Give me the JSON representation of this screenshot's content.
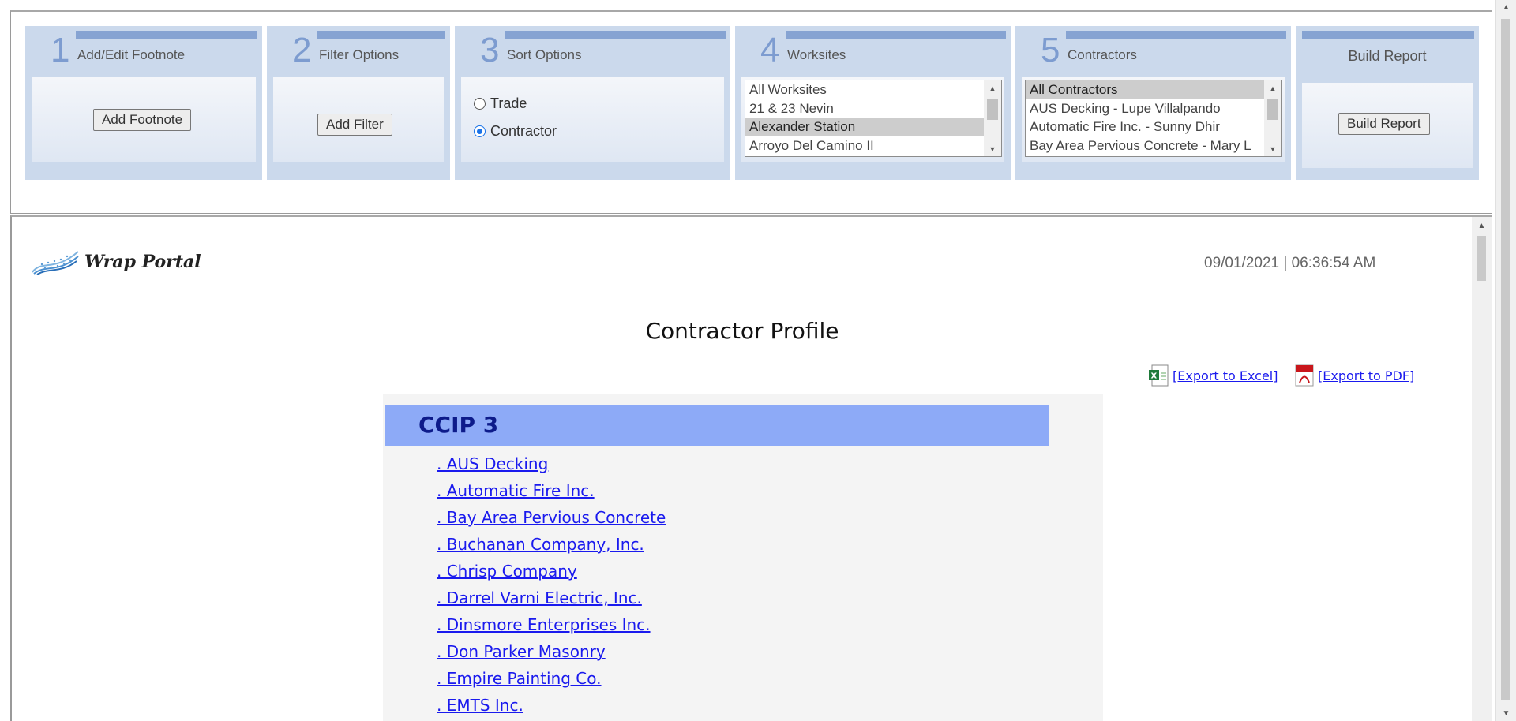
{
  "steps": [
    {
      "num": "1",
      "title": "Add/Edit Footnote",
      "button": "Add Footnote"
    },
    {
      "num": "2",
      "title": "Filter Options",
      "button": "Add Filter"
    },
    {
      "num": "3",
      "title": "Sort Options",
      "radios": [
        {
          "label": "Trade",
          "checked": false
        },
        {
          "label": "Contractor",
          "checked": true
        }
      ]
    },
    {
      "num": "4",
      "title": "Worksites",
      "options": [
        "All Worksites",
        "21 & 23 Nevin",
        "Alexander Station",
        "Arroyo Del Camino II"
      ],
      "selected": "Alexander Station"
    },
    {
      "num": "5",
      "title": "Contractors",
      "options": [
        "All Contractors",
        "AUS Decking - Lupe Villalpando",
        "Automatic Fire Inc. - Sunny Dhir",
        "Bay Area Pervious Concrete - Mary L"
      ],
      "selected": "All Contractors"
    },
    {
      "title": "Build Report",
      "button": "Build Report"
    }
  ],
  "report": {
    "logo_text": "Wrap Portal",
    "timestamp": "09/01/2021 | 06:36:54 AM",
    "title": "Contractor Profile",
    "export_excel": "[Export to Excel]",
    "export_pdf": "[Export to PDF]",
    "group": "CCIP 3",
    "contractors": [
      ". AUS Decking",
      ". Automatic Fire Inc.",
      ". Bay Area Pervious Concrete",
      ". Buchanan Company, Inc.",
      ". Chrisp Company",
      ". Darrel Varni Electric, Inc.",
      ". Dinsmore Enterprises Inc.",
      ". Don Parker Masonry",
      ". Empire Painting Co.",
      ". EMTS Inc."
    ]
  },
  "colors": {
    "panel": "#cbd9ec",
    "accent_bar": "#86a3d2",
    "group_header": "#8daaf7",
    "link": "#1a1aee"
  }
}
